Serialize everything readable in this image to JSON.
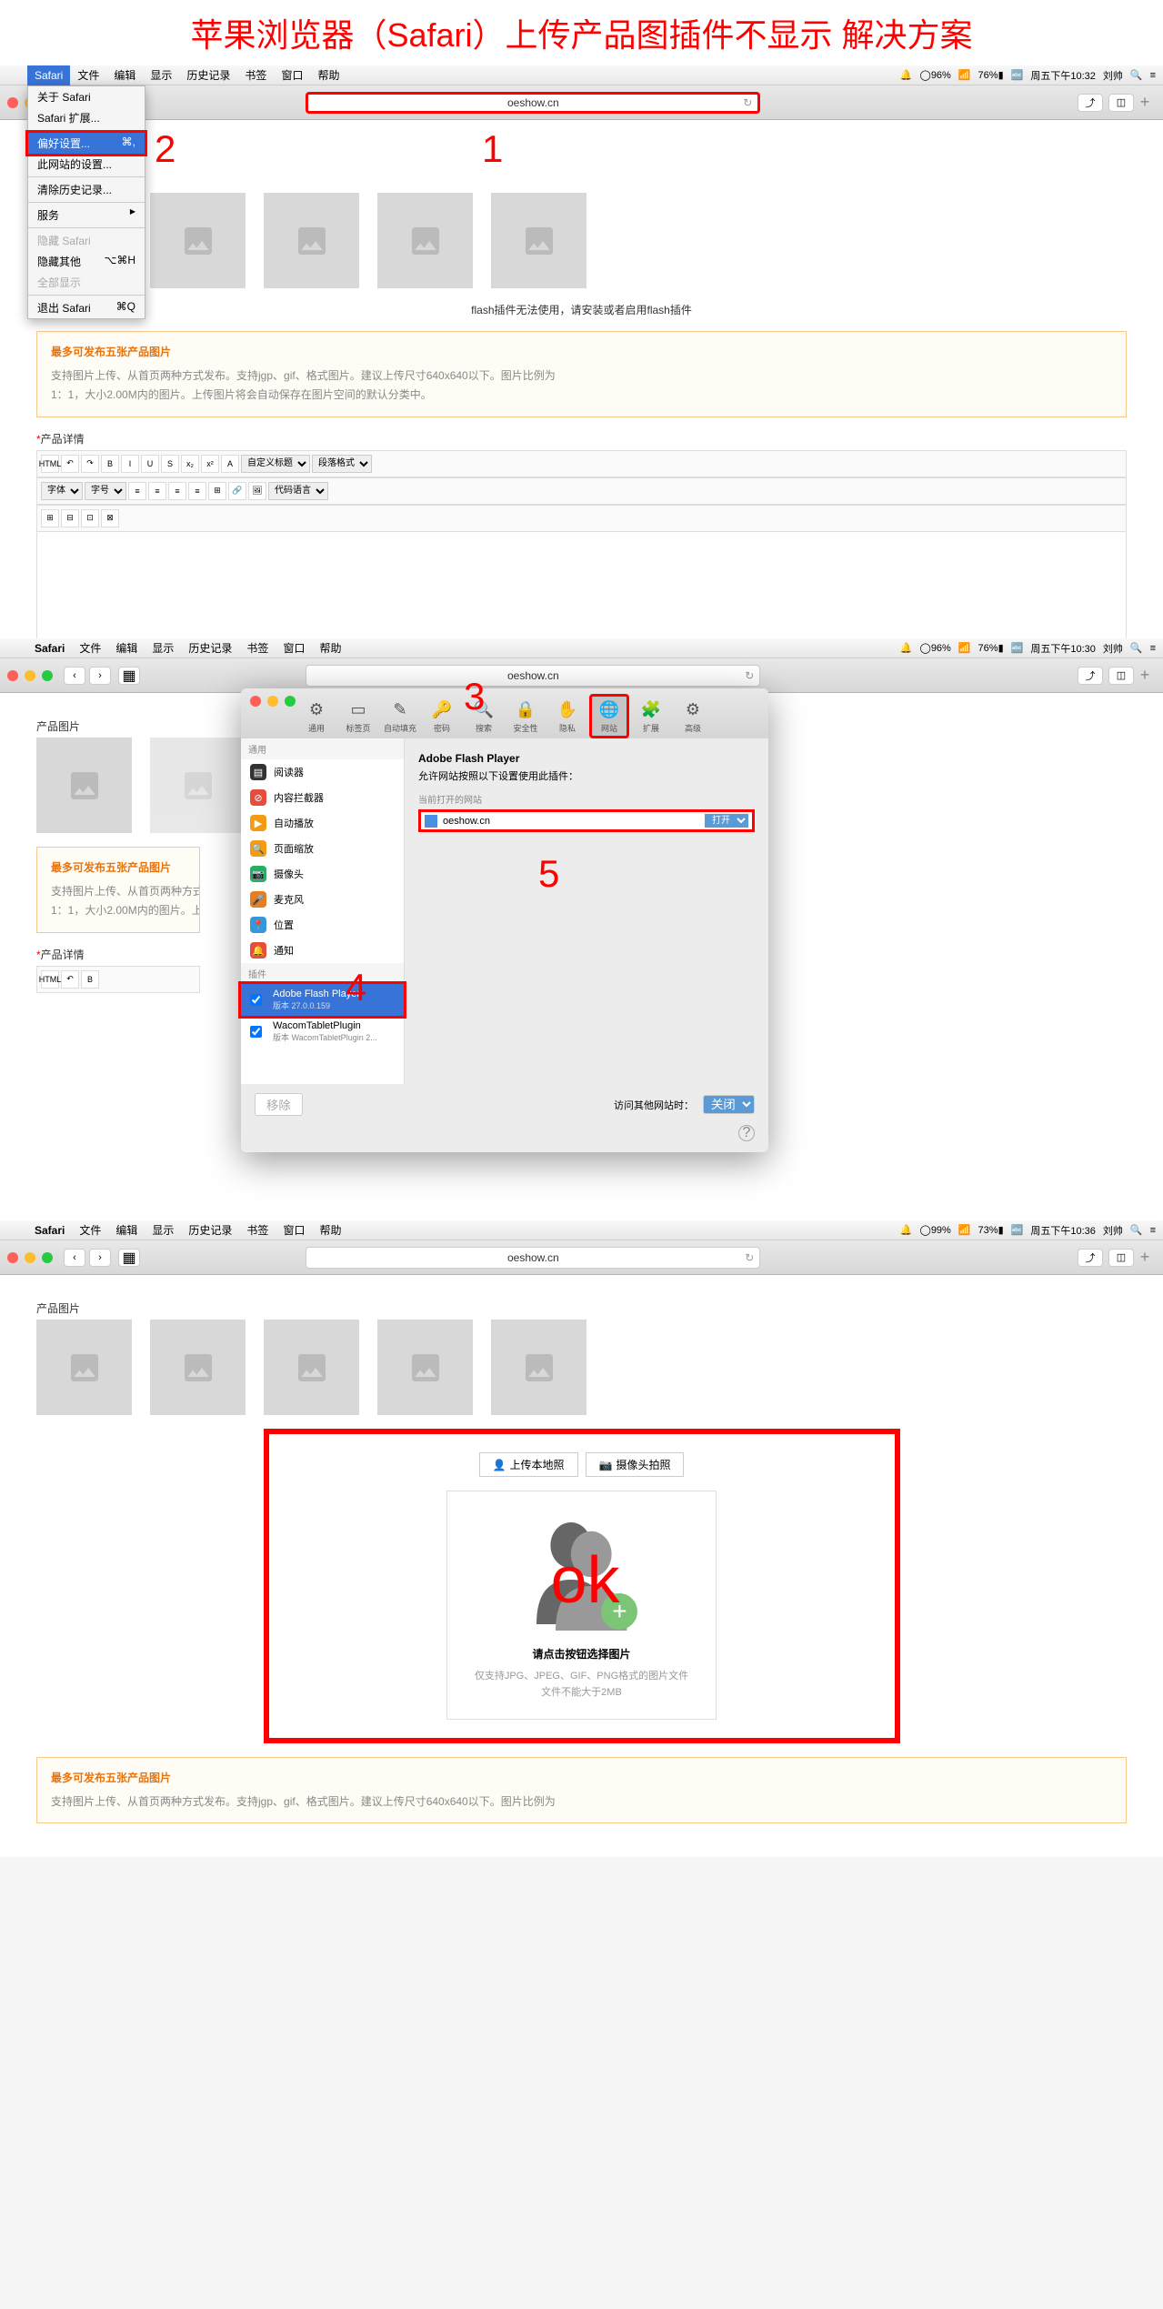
{
  "pageTitle": "苹果浏览器（Safari）上传产品图插件不显示 解决方案",
  "menubar": {
    "items": [
      "Safari",
      "文件",
      "编辑",
      "显示",
      "历史记录",
      "书签",
      "窗口",
      "帮助"
    ],
    "right": {
      "battery1": "96%",
      "wifi": "",
      "batt_pct1": "76%",
      "time1": "周五下午10:32",
      "user": "刘帅"
    }
  },
  "urlbar": {
    "domain": "oeshow.cn"
  },
  "dropdown": {
    "about": "关于 Safari",
    "extensions": "Safari 扩展...",
    "prefs": "偏好设置...",
    "prefs_shortcut": "⌘,",
    "site_settings": "此网站的设置...",
    "clear_history": "清除历史记录...",
    "services": "服务",
    "hide_safari": "隐藏 Safari",
    "hide_others": "隐藏其他",
    "hide_others_shortcut": "⌥⌘H",
    "show_all": "全部显示",
    "quit": "退出 Safari",
    "quit_shortcut": "⌘Q"
  },
  "content": {
    "flashMsg": "flash插件无法使用，请安装或者启用flash插件",
    "infoTitle": "最多可发布五张产品图片",
    "infoLine1": "支持图片上传、从首页两种方式发布。支持jgp、gif、格式图片。建议上传尺寸640x640以下。图片比例为",
    "infoLine2": "1：1，大小2.00M内的图片。上传图片将会自动保存在图片空间的默认分类中。",
    "sectionLabel": "产品详情",
    "imgSection": "产品图片"
  },
  "editor": {
    "fontLabel": "字体",
    "sizeLabel": "字号",
    "custom": "自定义标题",
    "paragraph": "段落格式",
    "codeLabel": "代码语言"
  },
  "status2": {
    "batt": "96%",
    "batt2": "76%",
    "time": "周五下午10:30"
  },
  "status3": {
    "batt": "99%",
    "batt2": "73%",
    "time": "周五下午10:36"
  },
  "settings": {
    "tabs": [
      "通用",
      "标签页",
      "自动填充",
      "密码",
      "搜索",
      "安全性",
      "隐私",
      "网站",
      "扩展",
      "高级"
    ],
    "sidebarHeader1": "通用",
    "sidebarItems": [
      "阅读器",
      "内容拦截器",
      "自动播放",
      "页面缩放",
      "摄像头",
      "麦克风",
      "位置",
      "通知"
    ],
    "sidebarHeader2": "插件",
    "plugin1": "Adobe Flash Player",
    "plugin1ver": "版本 27.0.0.159",
    "plugin2": "WacomTabletPlugin",
    "plugin2ver": "版本 WacomTabletPlugin 2...",
    "mainTitle": "Adobe Flash Player",
    "mainSub": "允许网站按照以下设置使用此插件：",
    "currentSites": "当前打开的网站",
    "siteDomain": "oeshow.cn",
    "siteAction": "打开",
    "removeBtn": "移除",
    "otherSitesLabel": "访问其他网站时：",
    "otherSitesVal": "关闭"
  },
  "upload": {
    "tab1": "上传本地照",
    "tab2": "摄像头拍照",
    "chooseBtn": "请点击按钮选择图片",
    "hint1": "仅支持JPG、JPEG、GIF、PNG格式的图片文件",
    "hint2": "文件不能大于2MB"
  },
  "annotations": {
    "n1": "1",
    "n2": "2",
    "n3": "3",
    "n4": "4",
    "n5": "5",
    "ok": "ok"
  }
}
